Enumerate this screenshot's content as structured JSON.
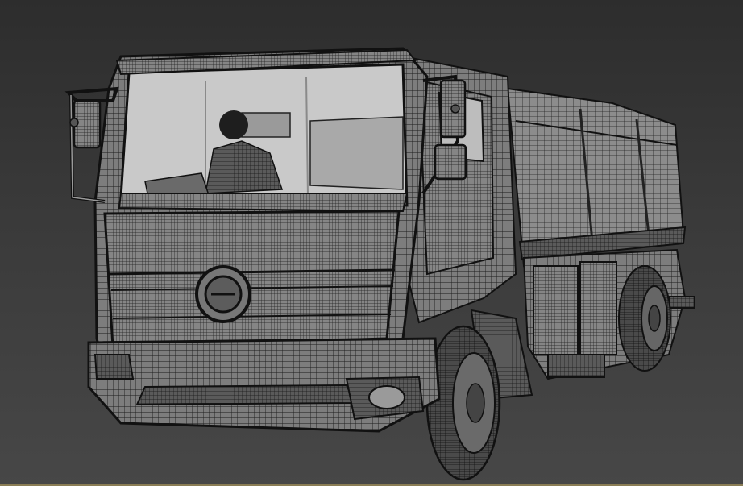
{
  "viewport": {
    "subject_icon": "wireframe-truck-icon",
    "colors": {
      "background_top": "#2d2d2d",
      "background_bottom": "#474747",
      "wire": "#1a1a1a",
      "surface": "#7a7a7a",
      "surface_light": "#9a9a9a",
      "glass": "#cfcfcf",
      "edge": "#8a7d55"
    }
  }
}
